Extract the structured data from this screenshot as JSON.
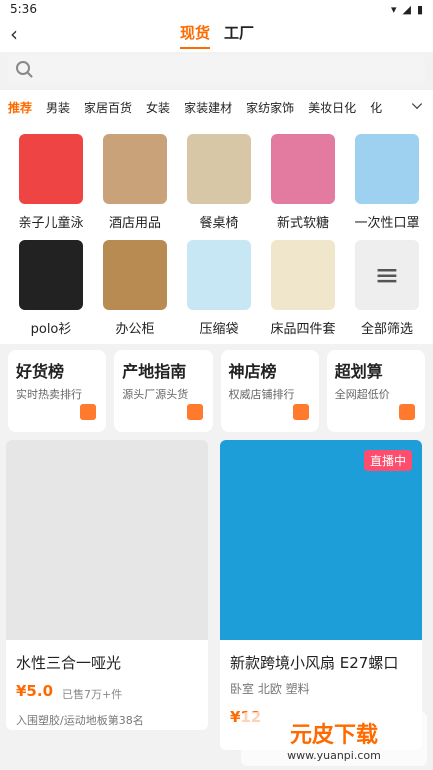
{
  "status": {
    "time": "5:36"
  },
  "header": {
    "tabs": [
      {
        "label": "现货"
      },
      {
        "label": "工厂"
      }
    ]
  },
  "search": {
    "placeholder": ""
  },
  "categories": [
    "推荐",
    "男装",
    "家居百货",
    "女装",
    "家装建材",
    "家纺家饰",
    "美妆日化",
    "化"
  ],
  "grid": [
    {
      "label": "亲子儿童泳",
      "color": "#e44"
    },
    {
      "label": "酒店用品",
      "color": "#c9a27a"
    },
    {
      "label": "餐桌椅",
      "color": "#d8c7a7"
    },
    {
      "label": "新式软糖",
      "color": "#e37ba0"
    },
    {
      "label": "一次性口罩",
      "color": "#9ed0f0"
    },
    {
      "label": "polo衫",
      "color": "#222"
    },
    {
      "label": "办公柜",
      "color": "#b88b52"
    },
    {
      "label": "压缩袋",
      "color": "#c7e7f4"
    },
    {
      "label": "床品四件套",
      "color": "#efe6cc"
    },
    {
      "label": "全部筛选",
      "color": "#eee"
    }
  ],
  "strip": [
    {
      "title": "好货榜",
      "sub": "实时热卖排行"
    },
    {
      "title": "产地指南",
      "sub": "源头厂源头货"
    },
    {
      "title": "神店榜",
      "sub": "权威店铺排行"
    },
    {
      "title": "超划算",
      "sub": "全网超低价"
    }
  ],
  "products": [
    {
      "name": "水性三合一哑光",
      "price": "¥5.0",
      "sold": "已售7万+件",
      "rank": "入围塑胶/运动地板第38名",
      "img_color": "#e6e6e6"
    },
    {
      "name": "新款跨境小风扇 E27螺口",
      "tags": "卧室  北欧  塑料",
      "price": "¥12",
      "live": "直播中",
      "img_color": "#1e9ed8"
    }
  ],
  "watermark": {
    "main": "元皮下载",
    "url": "www.yuanpi.com"
  },
  "colors": {
    "accent": "#ff6a00"
  }
}
